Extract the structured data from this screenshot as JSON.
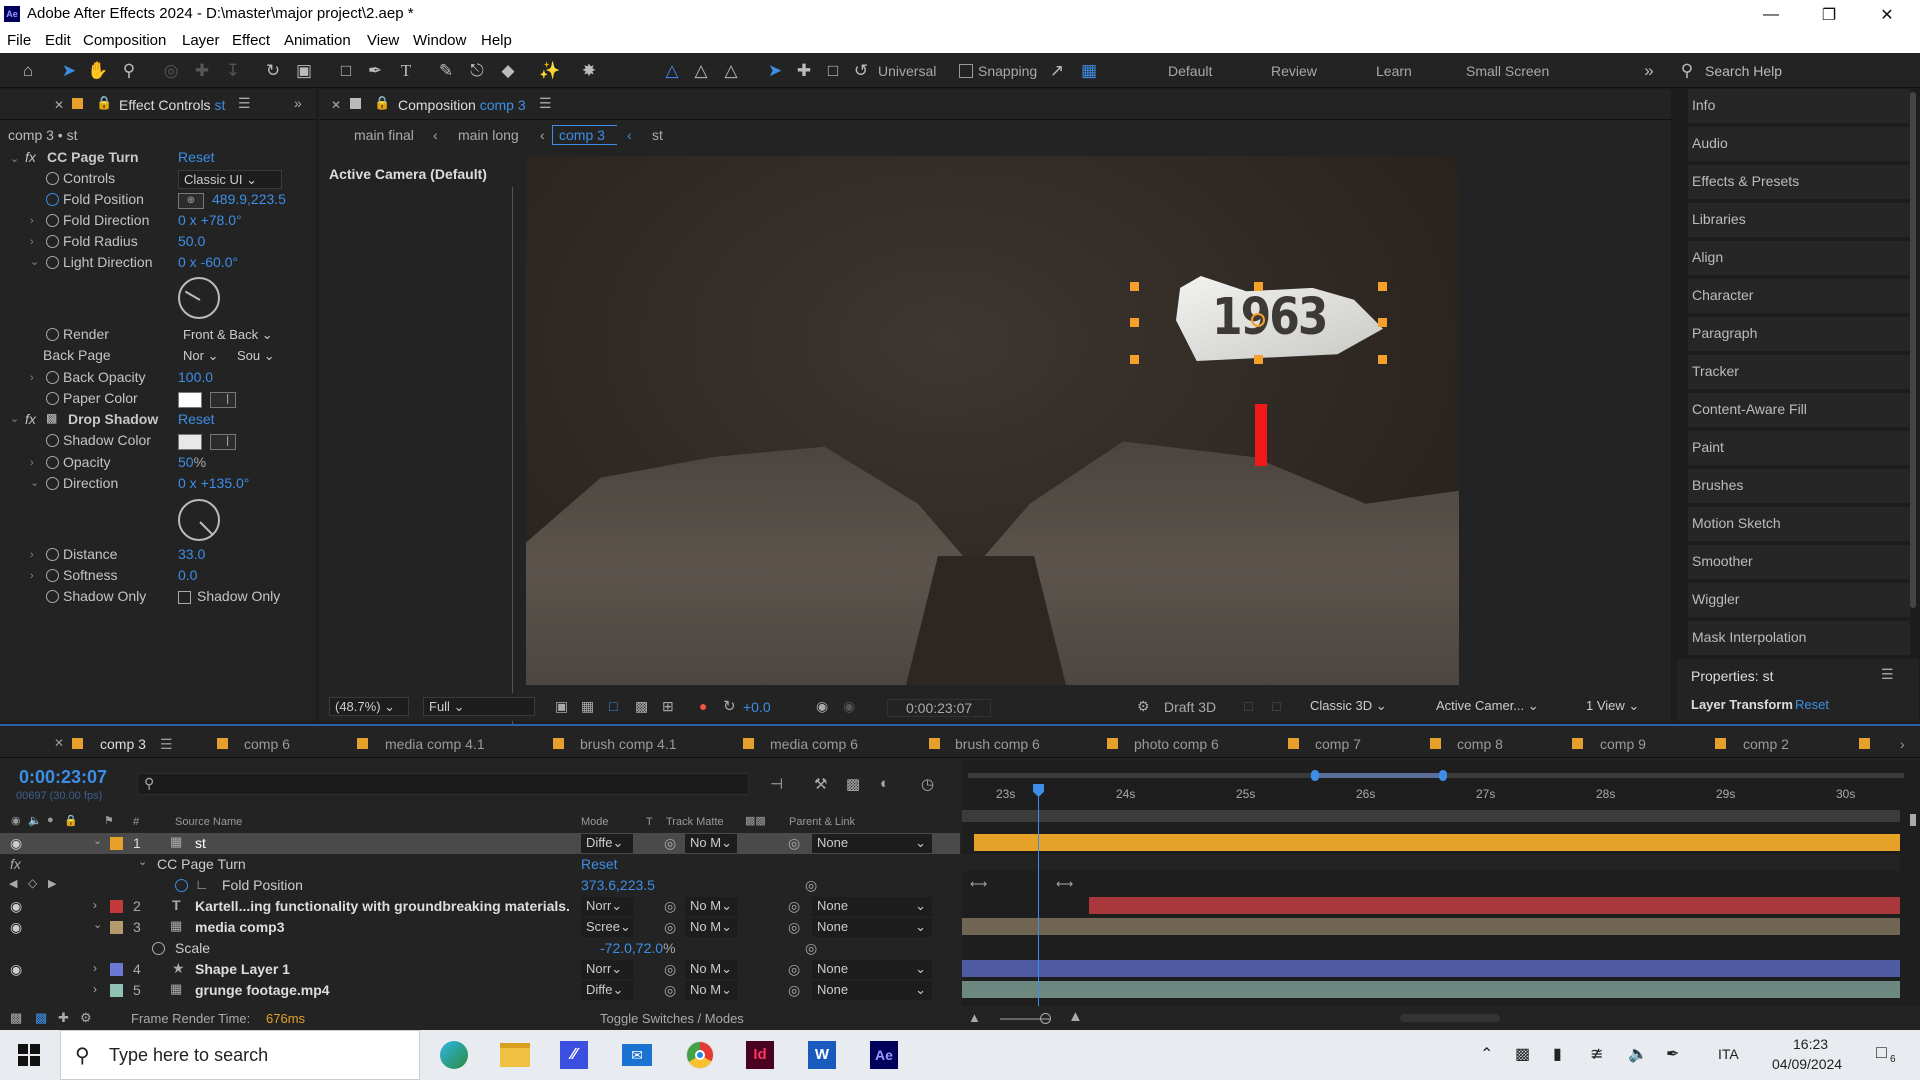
{
  "app": {
    "title": "Adobe After Effects 2024 - D:\\master\\major project\\2.aep *"
  },
  "menu": [
    "File",
    "Edit",
    "Composition",
    "Layer",
    "Effect",
    "Animation",
    "View",
    "Window",
    "Help"
  ],
  "toolbar": {
    "universal": "Universal",
    "snapping": "Snapping",
    "workspaces": [
      "Default",
      "Review",
      "Learn",
      "Small Screen"
    ],
    "search_placeholder": "Search Help"
  },
  "effect_controls": {
    "tab_label": "Effect Controls",
    "tab_layer": "st",
    "breadcrumb": "comp 3 • st",
    "cc_page_turn": {
      "name": "CC Page Turn",
      "reset": "Reset",
      "controls_label": "Controls",
      "controls_value": "Classic UI",
      "fold_position_label": "Fold Position",
      "fold_position_value": "489.9,223.5",
      "fold_direction_label": "Fold Direction",
      "fold_direction_value": "0 x +78.0°",
      "fold_radius_label": "Fold Radius",
      "fold_radius_value": "50.0",
      "light_direction_label": "Light Direction",
      "light_direction_value": "0 x -60.0°",
      "render_label": "Render",
      "render_value": "Front & Back",
      "back_page_label": "Back Page",
      "back_page_value1": "Nor",
      "back_page_value2": "Sou",
      "back_opacity_label": "Back Opacity",
      "back_opacity_value": "100.0",
      "paper_color_label": "Paper Color",
      "paper_color": "#ffffff"
    },
    "drop_shadow": {
      "name": "Drop Shadow",
      "reset": "Reset",
      "shadow_color_label": "Shadow Color",
      "opacity_label": "Opacity",
      "opacity_value": "50",
      "opacity_unit": "%",
      "direction_label": "Direction",
      "direction_value": "0 x +135.0°",
      "distance_label": "Distance",
      "distance_value": "33.0",
      "softness_label": "Softness",
      "softness_value": "0.0",
      "shadow_only_label": "Shadow Only",
      "shadow_only_checkbox": "Shadow Only"
    }
  },
  "composition": {
    "tab_label": "Composition",
    "tab_comp": "comp 3",
    "nav": [
      "main final",
      "main long",
      "comp 3",
      "st"
    ],
    "camera_label": "Active Camera (Default)",
    "overlay_text": "1963",
    "footer": {
      "zoom": "(48.7%)",
      "resolution": "Full",
      "exposure": "+0.0",
      "timecode": "0:00:23:07",
      "draft3d": "Draft 3D",
      "renderer": "Classic 3D",
      "camera": "Active Camer...",
      "views": "1 View"
    }
  },
  "right_panels": [
    "Info",
    "Audio",
    "Effects & Presets",
    "Libraries",
    "Align",
    "Character",
    "Paragraph",
    "Tracker",
    "Content-Aware Fill",
    "Paint",
    "Brushes",
    "Motion Sketch",
    "Smoother",
    "Wiggler",
    "Mask Interpolation"
  ],
  "properties": {
    "title": "Properties: st",
    "layer_transform": "Layer Transform",
    "reset": "Reset"
  },
  "timeline": {
    "tabs": [
      "comp 3",
      "comp 6",
      "media comp 4.1",
      "brush comp 4.1",
      "media comp 6",
      "brush comp 6",
      "photo comp 6",
      "comp 7",
      "comp 8",
      "comp 9",
      "comp 2"
    ],
    "timecode": "0:00:23:07",
    "frames": "00697 (30.00 fps)",
    "headers": {
      "source_name": "Source Name",
      "mode": "Mode",
      "t": "T",
      "track_matte": "Track Matte",
      "parent_link": "Parent & Link",
      "hash": "#"
    },
    "ruler": [
      "23s",
      "24s",
      "25s",
      "26s",
      "27s",
      "28s",
      "29s",
      "30s"
    ],
    "layers": [
      {
        "num": "1",
        "name": "st",
        "mode": "Diffe",
        "matte": "No M",
        "parent": "None",
        "label_color": "#e8a02c"
      },
      {
        "num": "2",
        "name": "Kartell...ing functionality with groundbreaking materials.",
        "mode": "Norr",
        "matte": "No M",
        "parent": "None",
        "label_color": "#c23a3a"
      },
      {
        "num": "3",
        "name": "media comp3",
        "mode": "Scree",
        "matte": "No M",
        "parent": "None",
        "label_color": "#b59a6e"
      },
      {
        "num": "4",
        "name": "Shape Layer 1",
        "mode": "Norr",
        "matte": "No M",
        "parent": "None",
        "label_color": "#6a78d8"
      },
      {
        "num": "5",
        "name": "grunge footage.mp4",
        "mode": "Diffe",
        "matte": "No M",
        "parent": "None",
        "label_color": "#8fc2b5"
      }
    ],
    "sub_effect": "CC Page Turn",
    "sub_reset": "Reset",
    "fold_position_label": "Fold Position",
    "fold_position_value": "373.6,223.5",
    "scale_label": "Scale",
    "scale_value": "-72.0,72.0",
    "scale_unit": "%",
    "footer": {
      "render_label": "Frame Render Time:",
      "render_value": "676ms",
      "toggle": "Toggle Switches / Modes"
    }
  },
  "taskbar": {
    "search_placeholder": "Type here to search",
    "lang": "ITA",
    "time": "16:23",
    "date": "04/09/2024",
    "notif": "6"
  }
}
